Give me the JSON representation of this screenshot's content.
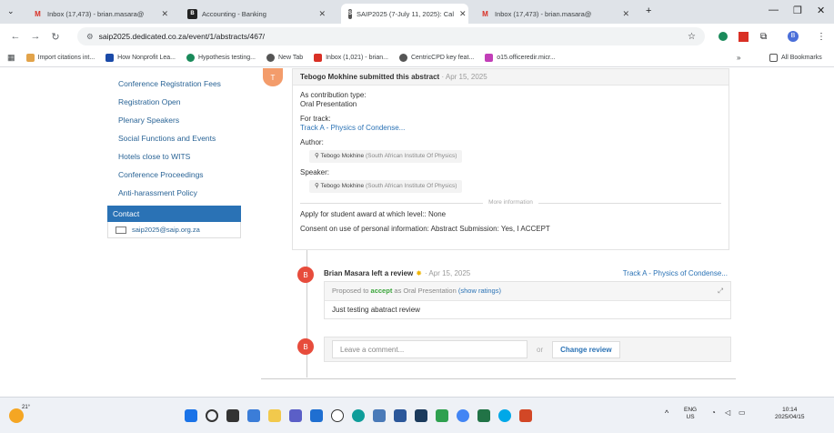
{
  "browser": {
    "tabs": [
      {
        "title": "Inbox (17,473) - brian.masara@",
        "active": false
      },
      {
        "title": "Accounting - Banking",
        "active": false
      },
      {
        "title": "SAIP2025 (7-July 11, 2025): Cal",
        "active": true
      },
      {
        "title": "Inbox (17,473) - brian.masara@",
        "active": false
      }
    ],
    "url": "saip2025.dedicated.co.za/event/1/abstracts/467/",
    "bookmarks": [
      "Import citations int...",
      "How Nonprofit Lea...",
      "Hypothesis testing...",
      "New Tab",
      "Inbox (1,021) - brian...",
      "CentricCPD key feat...",
      "o15.officeredir.micr..."
    ],
    "all_bookmarks": "All Bookmarks"
  },
  "sidebar": {
    "items": [
      "Conference Registration Fees",
      "Registration Open",
      "Plenary Speakers",
      "Social Functions and Events",
      "Hotels close to WITS",
      "Conference Proceedings",
      "Anti-harassment Policy"
    ],
    "contact_title": "Contact",
    "contact_email": "saip2025@saip.org.za"
  },
  "abstract": {
    "avatar_letter": "T",
    "author_action": "Tebogo Mokhine submitted this abstract",
    "date": "· Apr 15, 2025",
    "contribution_label": "As contribution type:",
    "contribution_value": "Oral Presentation",
    "track_label": "For track:",
    "track_value": "Track A - Physics of Condense...",
    "author_label": "Author:",
    "author_name": "Tebogo Mokhine",
    "author_inst": "(South African Institute Of Physics)",
    "speaker_label": "Speaker:",
    "speaker_name": "Tebogo Mokhine",
    "speaker_inst": "(South African Institute Of Physics)",
    "more_info": "More information",
    "award": "Apply for student award at which level:: None",
    "consent": "Consent on use of personal information: Abstract Submission: Yes, I ACCEPT"
  },
  "review": {
    "avatar_letter": "B",
    "reviewer": "Brian Masara left a review",
    "date": "· Apr 15, 2025",
    "track": "Track A - Physics of Condense...",
    "proposed_prefix": "Proposed to",
    "proposed_action": "accept",
    "proposed_as": "as Oral Presentation",
    "show_ratings": "(show ratings)",
    "text": "Just testing abatract review"
  },
  "comment": {
    "avatar_letter": "B",
    "placeholder": "Leave a comment...",
    "or": "or",
    "change_review": "Change review"
  },
  "taskbar": {
    "weather": "21°",
    "lang": "ENG",
    "region": "US",
    "time": "10:14",
    "date": "2025/04/15"
  },
  "colors": {
    "accent": "#2a72b5",
    "avatar": "#e74c3c",
    "accept": "#3aa53a"
  }
}
